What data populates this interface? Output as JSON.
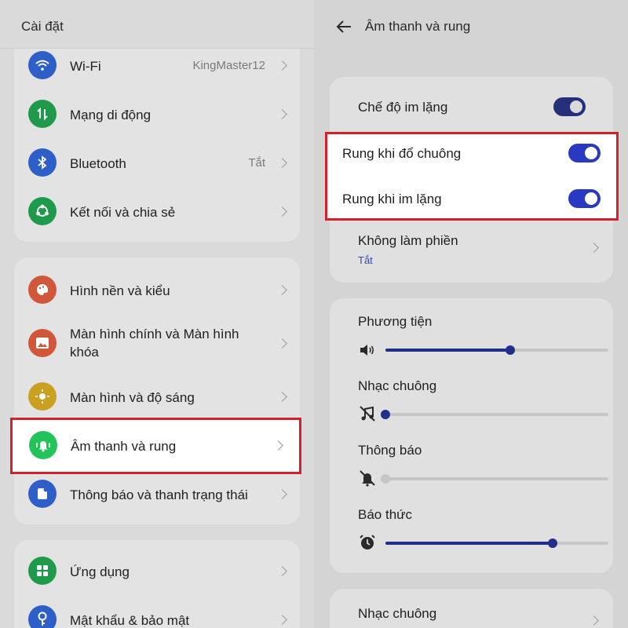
{
  "left": {
    "title": "Cài đặt",
    "group1": [
      {
        "label": "Wi-Fi",
        "value": "KingMaster12",
        "icon": "wifi-icon",
        "color": "#2e5fc9"
      },
      {
        "label": "Mạng di động",
        "value": "",
        "icon": "mobile-data-icon",
        "color": "#1e9a4a"
      },
      {
        "label": "Bluetooth",
        "value": "Tắt",
        "icon": "bluetooth-icon",
        "color": "#2e5fc9"
      },
      {
        "label": "Kết nối và chia sẻ",
        "value": "",
        "icon": "share-icon",
        "color": "#1e9a4a"
      }
    ],
    "group2": [
      {
        "label": "Hình nền và kiểu",
        "icon": "palette-icon",
        "color": "#d0573a"
      },
      {
        "label": "Màn hình chính và Màn hình khóa",
        "icon": "image-icon",
        "color": "#d0573a"
      },
      {
        "label": "Màn hình và độ sáng",
        "icon": "brightness-icon",
        "color": "#c9a020"
      },
      {
        "label": "Âm thanh và rung",
        "icon": "sound-vibration-icon",
        "color": "#22c45a"
      },
      {
        "label": "Thông báo và thanh trạng thái",
        "icon": "notification-icon",
        "color": "#2e5fc9"
      }
    ],
    "group3": [
      {
        "label": "Ứng dụng",
        "icon": "apps-icon",
        "color": "#1e9a4a"
      },
      {
        "label": "Mật khẩu & bảo mật",
        "icon": "key-icon",
        "color": "#2e5fc9"
      }
    ]
  },
  "right": {
    "title": "Âm thanh và rung",
    "silent_mode": "Chế độ im lặng",
    "vibrate_ring": "Rung khi đổ chuông",
    "vibrate_silent": "Rung khi im lặng",
    "dnd": "Không làm phiền",
    "dnd_status": "Tắt",
    "volumes": [
      {
        "label": "Phương tiện",
        "icon": "speaker-icon",
        "level": 0.56
      },
      {
        "label": "Nhạc chuông",
        "icon": "ringtone-muted-icon",
        "level": 0.0
      },
      {
        "label": "Thông báo",
        "icon": "notification-muted-icon",
        "level": 0.0
      },
      {
        "label": "Báo thức",
        "icon": "alarm-icon",
        "level": 0.75
      }
    ],
    "ringtone_section": "Nhạc chuông"
  }
}
